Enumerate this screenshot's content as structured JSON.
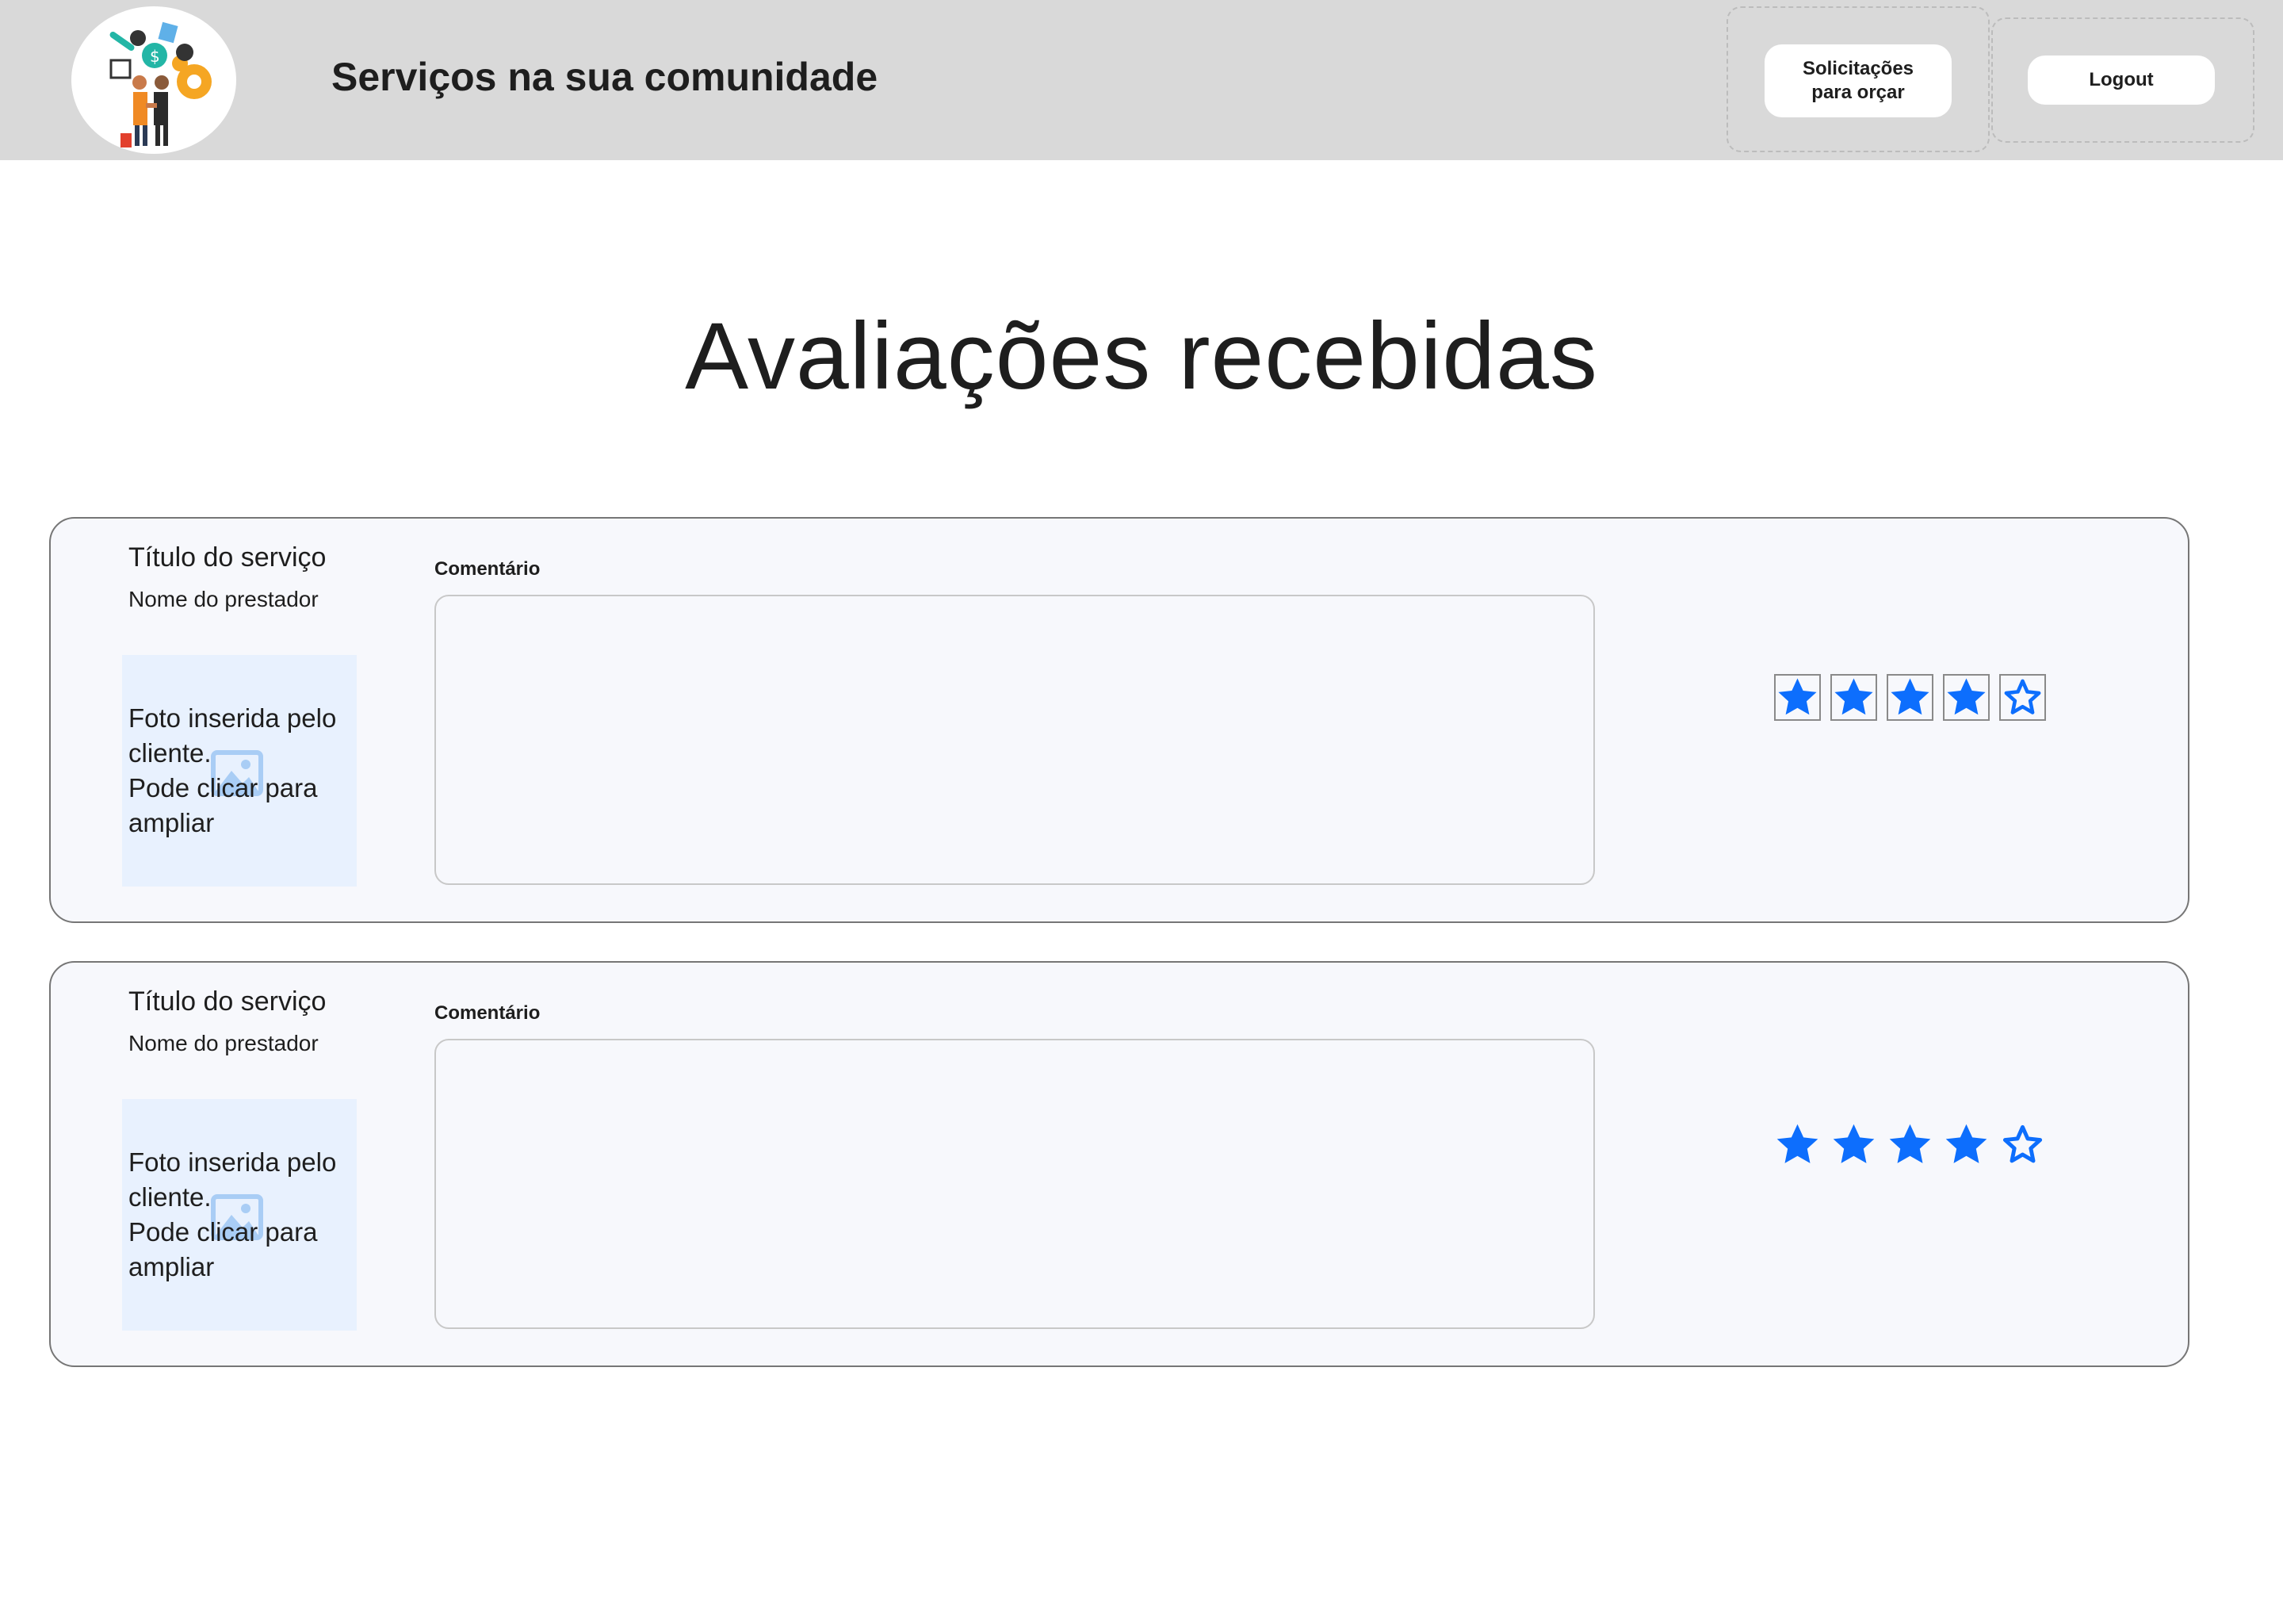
{
  "header": {
    "site_title": "Serviços na sua comunidade",
    "nav": {
      "solicitacoes_label": "Solicitações\npara orçar",
      "logout_label": "Logout"
    }
  },
  "page": {
    "heading": "Avaliações recebidas"
  },
  "reviews": [
    {
      "service_title": "Título do serviço",
      "provider_name": "Nome do prestador",
      "photo_text": "Foto inserida pelo\ncliente.\nPode clicar para\nampliar",
      "comment_label": "Comentário",
      "comment_value": "",
      "rating": 4,
      "rating_max": 5
    },
    {
      "service_title": "Título do serviço",
      "provider_name": "Nome do prestador",
      "photo_text": "Foto inserida pelo\ncliente.\nPode clicar para\nampliar",
      "comment_label": "Comentário",
      "comment_value": "",
      "rating": 4,
      "rating_max": 5
    }
  ],
  "colors": {
    "header_bg": "#d9d9d9",
    "star_color": "#0d6efd",
    "card_bg": "#f7f8fc",
    "photo_bg": "#e8f1fe"
  },
  "icons": {
    "logo": "community-services-logo",
    "photo_placeholder": "image-icon",
    "rating_star_filled": "star-filled-icon",
    "rating_star_empty": "star-outline-icon"
  }
}
